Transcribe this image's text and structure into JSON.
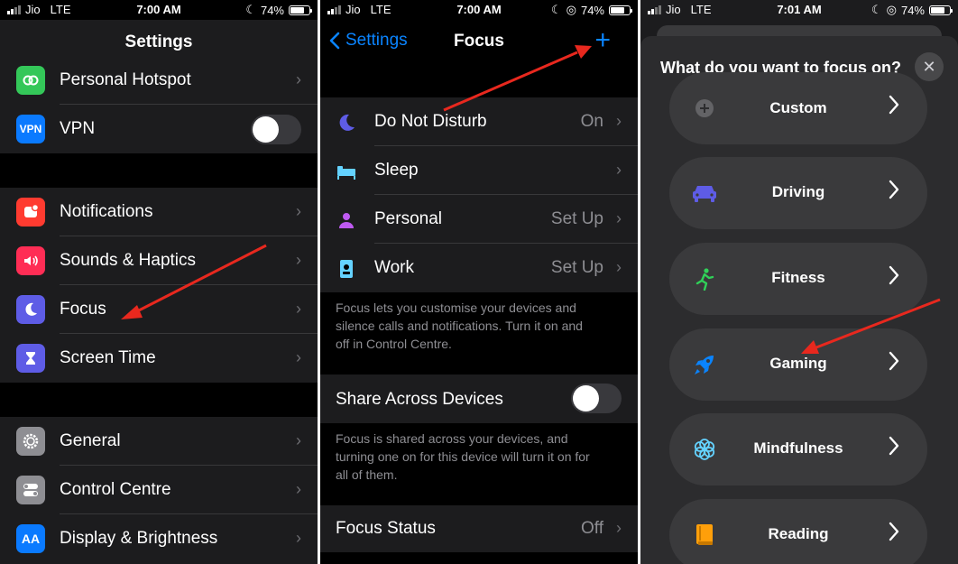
{
  "status": {
    "carrier": "Jio",
    "network": "LTE",
    "battery": "74%",
    "battery_level": 0.74,
    "times": [
      "7:00 AM",
      "7:00 AM",
      "7:01 AM"
    ]
  },
  "settings_screen": {
    "title": "Settings",
    "group1": [
      {
        "label": "Personal Hotspot",
        "icon": "hotspot-icon",
        "color": "#34c759"
      },
      {
        "label": "VPN",
        "icon": "vpn-icon",
        "icon_text": "VPN",
        "color": "#0a7aff"
      }
    ],
    "group2": [
      {
        "label": "Notifications",
        "icon": "notifications-icon",
        "color": "#ff3b30"
      },
      {
        "label": "Sounds & Haptics",
        "icon": "sounds-icon",
        "color": "#ff2d55"
      },
      {
        "label": "Focus",
        "icon": "moon-icon",
        "color": "#5e5ce6"
      },
      {
        "label": "Screen Time",
        "icon": "hourglass-icon",
        "color": "#5e5ce6"
      }
    ],
    "group3": [
      {
        "label": "General",
        "icon": "gear-icon",
        "color": "#8e8e93"
      },
      {
        "label": "Control Centre",
        "icon": "toggles-icon",
        "color": "#8e8e93"
      },
      {
        "label": "Display & Brightness",
        "icon": "display-icon",
        "icon_text": "AA",
        "color": "#0a7aff"
      }
    ],
    "chevron": "›"
  },
  "focus_screen": {
    "back_label": "Settings",
    "title": "Focus",
    "add_label": "+",
    "items": [
      {
        "label": "Do Not Disturb",
        "value": "On",
        "icon": "moon-icon",
        "color": "#5e5ce6"
      },
      {
        "label": "Sleep",
        "value": "",
        "icon": "bed-icon",
        "color": "#64d2ff"
      },
      {
        "label": "Personal",
        "value": "Set Up",
        "icon": "person-icon",
        "color": "#bf5af2"
      },
      {
        "label": "Work",
        "value": "Set Up",
        "icon": "badge-icon",
        "color": "#64d2ff"
      }
    ],
    "footer1_lines": [
      "Focus lets you customise your devices and",
      "silence calls and notifications. Turn it on and",
      "off in Control Centre."
    ],
    "share_label": "Share Across Devices",
    "footer2_lines": [
      "Focus is shared across your devices, and",
      "turning one on for this device will turn it on for",
      "all of them."
    ],
    "status_label": "Focus Status",
    "status_value": "Off"
  },
  "picker_screen": {
    "question": "What do you want to focus on?",
    "close_label": "✕",
    "options": [
      {
        "label": "Custom",
        "icon": "plus-circle-icon",
        "color": "#8e8e93"
      },
      {
        "label": "Driving",
        "icon": "car-icon",
        "color": "#5e5ce6"
      },
      {
        "label": "Fitness",
        "icon": "running-icon",
        "color": "#30d158"
      },
      {
        "label": "Gaming",
        "icon": "rocket-icon",
        "color": "#0a84ff"
      },
      {
        "label": "Mindfulness",
        "icon": "flower-icon",
        "color": "#64d2ff"
      },
      {
        "label": "Reading",
        "icon": "book-icon",
        "color": "#ff9f0a"
      }
    ]
  },
  "annotation_color": "#e8281e"
}
